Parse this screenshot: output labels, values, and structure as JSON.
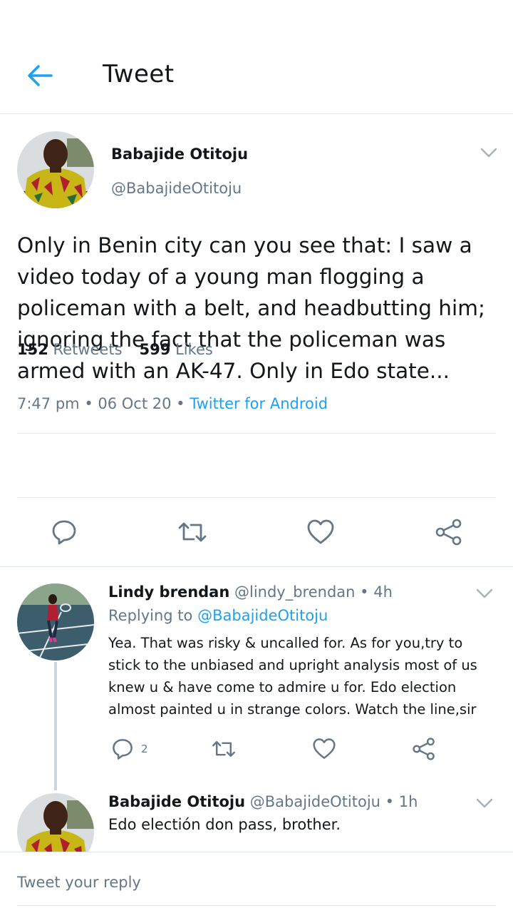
{
  "colors": {
    "accent": "#1da1f2",
    "secondary_text": "#657786",
    "divider": "#e1e8ed"
  },
  "header": {
    "title": "Tweet",
    "back_icon": "arrow-left-icon"
  },
  "main_tweet": {
    "author_name": "Babajide Otitoju",
    "author_handle": "@BabajideOtitoju",
    "text": "Only in Benin city can you see that: I saw a video today of a young man flogging a policeman with a belt, and headbutting him; ignoring the fact that the policeman was armed with an AK-47. Only in Edo state...",
    "time": "7:47 pm",
    "date": "06 Oct 20",
    "source": "Twitter for Android",
    "retweet_count": "152",
    "retweet_label": "Retweets",
    "like_count": "599",
    "like_label": "Likes"
  },
  "replies": [
    {
      "author_name": "Lindy brendan",
      "author_handle": "@lindy_brendan",
      "age": "4h",
      "replying_label": "Replying to",
      "replying_to": "@BabajideOtitoju",
      "text": "Yea. That was risky & uncalled for. As for you,try to stick to the unbiased and upright analysis most of us knew u & have come to admire u for. Edo election almost painted u in strange colors. Watch the line,sir",
      "reply_count": "2"
    },
    {
      "author_name": "Babajide Otitoju",
      "author_handle": "@BabajideOtitoju",
      "age": "1h",
      "text": "Edo electión don pass, brother."
    }
  ],
  "composer": {
    "placeholder": "Tweet your reply"
  }
}
